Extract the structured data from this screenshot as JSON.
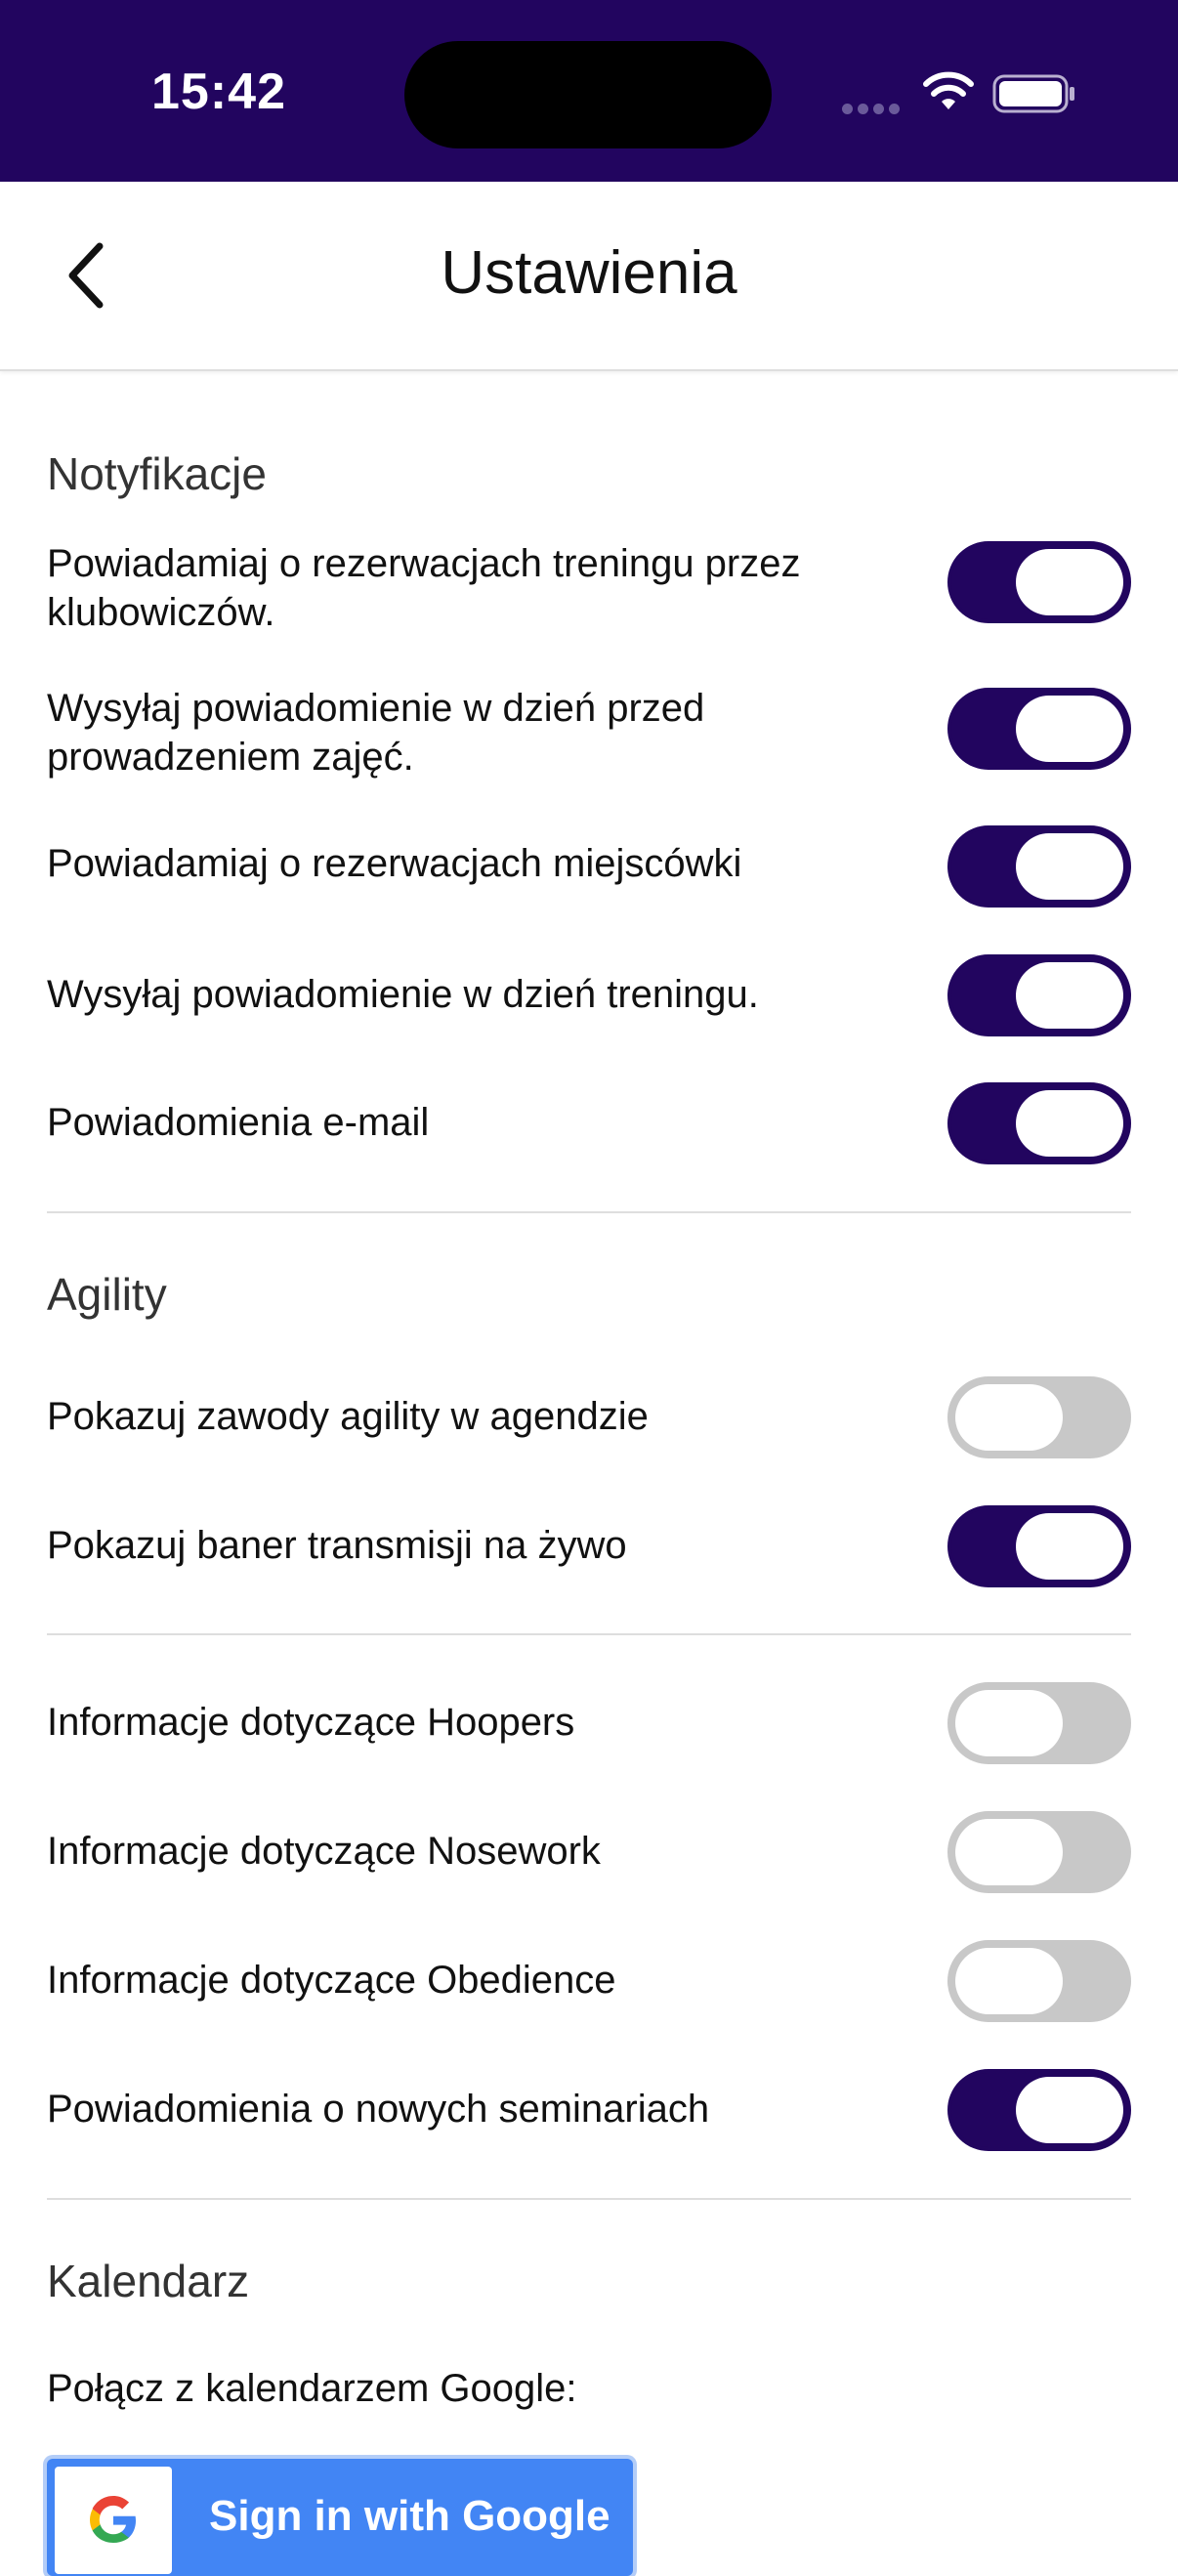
{
  "status_bar": {
    "time": "15:42"
  },
  "nav": {
    "title": "Ustawienia"
  },
  "sections": {
    "notifications": {
      "title": "Notyfikacje",
      "rows": [
        {
          "label": "Powiadamiaj o rezerwacjach treningu przez klubowiczów.",
          "on": true
        },
        {
          "label": "Wysyłaj powiadomienie w dzień przed prowadzeniem zajęć.",
          "on": true
        },
        {
          "label": "Powiadamiaj o rezerwacjach miejscówki",
          "on": true
        },
        {
          "label": "Wysyłaj powiadomienie w dzień treningu.",
          "on": true
        },
        {
          "label": "Powiadomienia e-mail",
          "on": true
        }
      ]
    },
    "agility": {
      "title": "Agility",
      "rows": [
        {
          "label": "Pokazuj zawody agility w agendzie",
          "on": false
        },
        {
          "label": "Pokazuj baner transmisji na żywo",
          "on": true
        }
      ]
    },
    "other": {
      "rows": [
        {
          "label": "Informacje dotyczące Hoopers",
          "on": false
        },
        {
          "label": "Informacje dotyczące Nosework",
          "on": false
        },
        {
          "label": "Informacje dotyczące Obedience",
          "on": false
        },
        {
          "label": "Powiadomienia o nowych seminariach",
          "on": true
        }
      ]
    },
    "calendar": {
      "title": "Kalendarz",
      "connect_label": "Połącz z kalendarzem Google:",
      "google_button_label": "Sign in with Google"
    }
  },
  "colors": {
    "accent": "#22055f",
    "toggle_off": "#c8c8c8",
    "google_blue": "#4285f4"
  }
}
